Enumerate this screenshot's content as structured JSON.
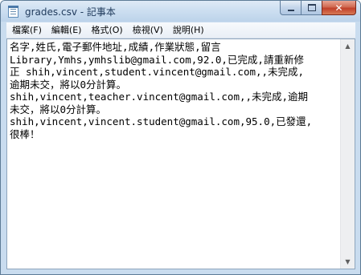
{
  "window": {
    "title": "grades.csv - 記事本",
    "controls": {
      "minimize": "minimize",
      "maximize": "maximize",
      "close": "✕"
    }
  },
  "menu": {
    "items": [
      {
        "label": "檔案(F)"
      },
      {
        "label": "編輯(E)"
      },
      {
        "label": "格式(O)"
      },
      {
        "label": "檢視(V)"
      },
      {
        "label": "說明(H)"
      }
    ]
  },
  "editor": {
    "lines": [
      "名字,姓氏,電子郵件地址,成績,作業狀態,留言",
      "Library,Ymhs,ymhslib@gmail.com,92.0,已完成,請重新修",
      "正 shih,vincent,student.vincent@gmail.com,,未完成,",
      "逾期未交，將以0分計算。",
      "shih,vincent,teacher.vincent@gmail.com,,未完成,逾期",
      "未交，將以0分計算。",
      "shih,vincent,vincent.student@gmail.com,95.0,已發還,",
      "很棒！"
    ]
  },
  "scrollbar": {
    "up_arrow": "▲",
    "down_arrow": "▼"
  },
  "colors": {
    "titlebar": "#cddff1",
    "close_button": "#c1402a",
    "text": "#000000"
  },
  "icons": {
    "app": "notepad-icon"
  }
}
